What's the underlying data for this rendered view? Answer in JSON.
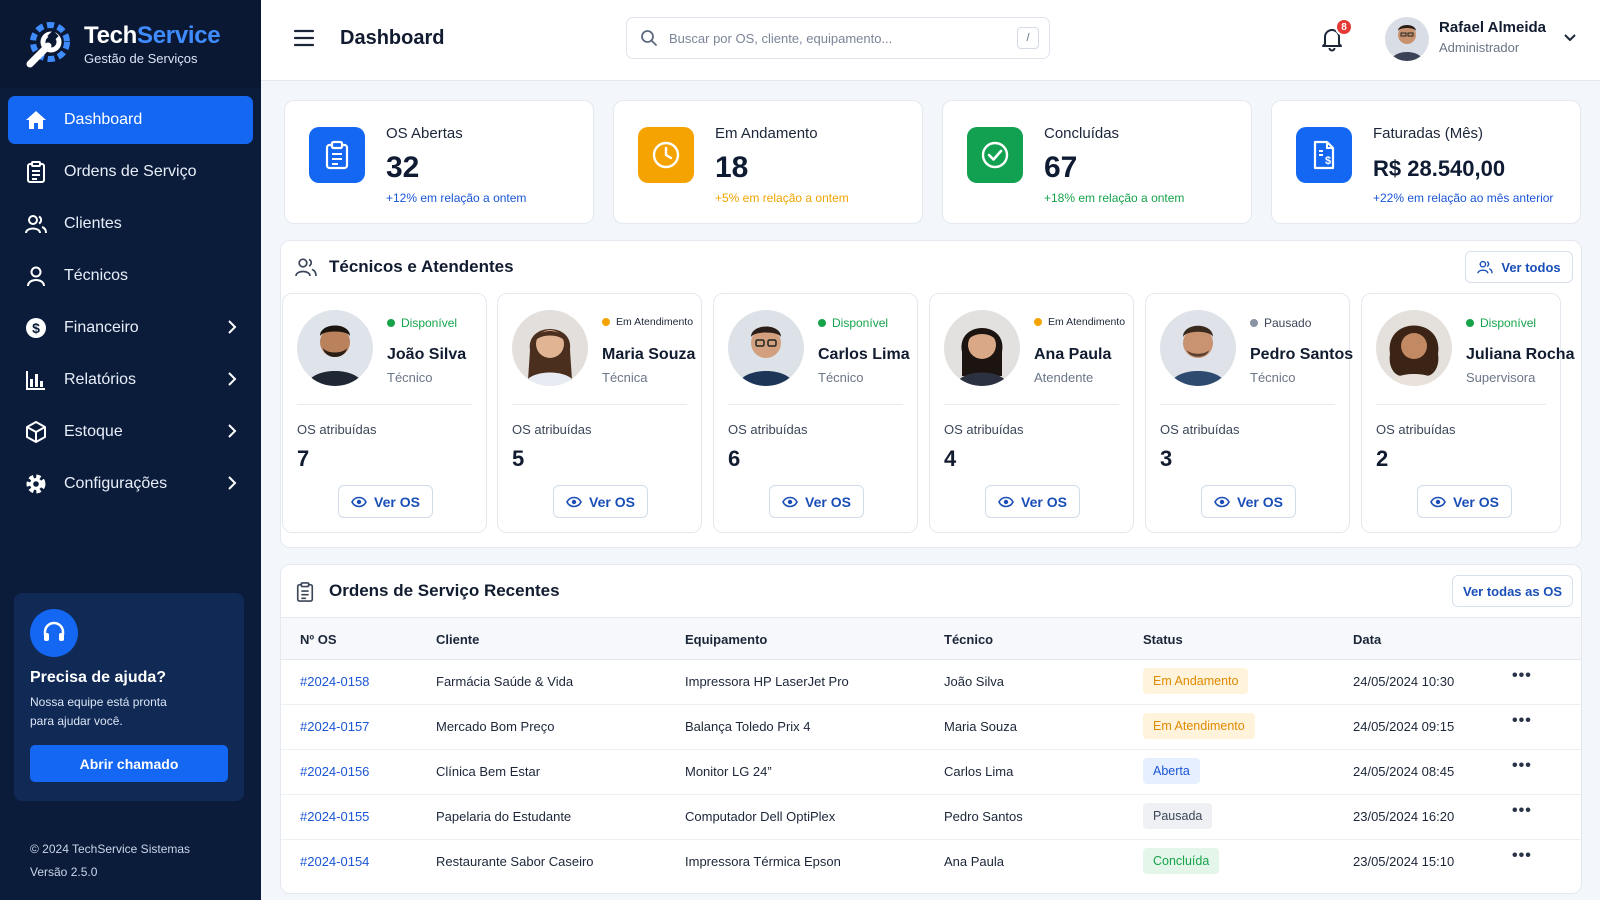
{
  "brand": {
    "name_part1": "Tech",
    "name_part2": "Service",
    "subtitle": "Gestão de Serviços"
  },
  "nav": {
    "items": [
      {
        "label": "Dashboard",
        "icon": "home-icon",
        "active": true
      },
      {
        "label": "Ordens de Serviço",
        "icon": "clipboard-icon"
      },
      {
        "label": "Clientes",
        "icon": "users-icon"
      },
      {
        "label": "Técnicos",
        "icon": "user-icon"
      },
      {
        "label": "Financeiro",
        "icon": "dollar-icon",
        "has_submenu": true
      },
      {
        "label": "Relatórios",
        "icon": "bar-chart-icon",
        "has_submenu": true
      },
      {
        "label": "Estoque",
        "icon": "box-icon",
        "has_submenu": true
      },
      {
        "label": "Configurações",
        "icon": "gear-icon",
        "has_submenu": true
      }
    ]
  },
  "help": {
    "title": "Precisa de ajuda?",
    "text": "Nossa equipe está pronta para ajudar você.",
    "button": "Abrir chamado"
  },
  "footer": {
    "copyright": "© 2024 TechService Sistemas",
    "version": "Versão 2.5.0"
  },
  "header": {
    "title": "Dashboard",
    "search_placeholder": "Buscar por OS, cliente, equipamento...",
    "search_shortcut": "/",
    "notifications": "8",
    "user_name": "Rafael Almeida",
    "user_role": "Administrador"
  },
  "stats": [
    {
      "title": "OS Abertas",
      "value": "32",
      "note": "+12% em relação a ontem",
      "color": "#1467f2",
      "note_color": "#1a56d6",
      "icon": "clipboard-icon"
    },
    {
      "title": "Em Andamento",
      "value": "18",
      "note": "+5% em relação a ontem",
      "color": "#f5a300",
      "note_color": "#f0a400",
      "icon": "clock-icon"
    },
    {
      "title": "Concluídas",
      "value": "67",
      "note": "+18% em relação a ontem",
      "color": "#12a150",
      "note_color": "#16a34a",
      "icon": "check-circle-icon"
    },
    {
      "title": "Faturadas (Mês)",
      "value": "R$ 28.540,00",
      "note": "+22% em relação ao mês anterior",
      "color": "#1467f2",
      "note_color": "#1a56d6",
      "icon": "invoice-icon"
    }
  ],
  "technicians": {
    "title": "Técnicos e Atendentes",
    "view_all": "Ver todos",
    "assigned_label": "OS atribuídas",
    "view_button": "Ver OS",
    "items": [
      {
        "name": "João Silva",
        "role": "Técnico",
        "status": "Disponível",
        "status_color": "#16a34a",
        "count": "7"
      },
      {
        "name": "Maria Souza",
        "role": "Técnica",
        "status": "Em Atendimento",
        "status_color": "#f5a300",
        "count": "5"
      },
      {
        "name": "Carlos Lima",
        "role": "Técnico",
        "status": "Disponível",
        "status_color": "#16a34a",
        "count": "6"
      },
      {
        "name": "Ana Paula",
        "role": "Atendente",
        "status": "Em Atendimento",
        "status_color": "#f5a300",
        "count": "4"
      },
      {
        "name": "Pedro Santos",
        "role": "Técnico",
        "status": "Pausado",
        "status_color": "#8a93a3",
        "count": "3"
      },
      {
        "name": "Juliana Rocha",
        "role": "Supervisora",
        "status": "Disponível",
        "status_color": "#16a34a",
        "count": "2"
      }
    ]
  },
  "orders": {
    "title": "Ordens de Serviço Recentes",
    "view_all": "Ver todas as OS",
    "columns": [
      "Nº OS",
      "Cliente",
      "Equipamento",
      "Técnico",
      "Status",
      "Data"
    ],
    "rows": [
      {
        "id": "#2024-0158",
        "client": "Farmácia Saúde & Vida",
        "equipment": "Impressora HP LaserJet Pro",
        "tech": "João Silva",
        "status": "Em Andamento",
        "status_bg": "#fff3dc",
        "status_fg": "#e08a00",
        "date": "24/05/2024 10:30"
      },
      {
        "id": "#2024-0157",
        "client": "Mercado Bom Preço",
        "equipment": "Balança Toledo Prix 4",
        "tech": "Maria Souza",
        "status": "Em Atendimento",
        "status_bg": "#fff3dc",
        "status_fg": "#e08a00",
        "date": "24/05/2024 09:15"
      },
      {
        "id": "#2024-0156",
        "client": "Clínica Bem Estar",
        "equipment": "Monitor LG 24”",
        "tech": "Carlos Lima",
        "status": "Aberta",
        "status_bg": "#e6efff",
        "status_fg": "#1a56d6",
        "date": "24/05/2024 08:45"
      },
      {
        "id": "#2024-0155",
        "client": "Papelaria do Estudante",
        "equipment": "Computador Dell OptiPlex",
        "tech": "Pedro Santos",
        "status": "Pausada",
        "status_bg": "#eef0f3",
        "status_fg": "#3c4659",
        "date": "23/05/2024 16:20"
      },
      {
        "id": "#2024-0154",
        "client": "Restaurante Sabor Caseiro",
        "equipment": "Impressora Térmica Epson",
        "tech": "Ana Paula",
        "status": "Concluída",
        "status_bg": "#e4f6ea",
        "status_fg": "#16a34a",
        "date": "23/05/2024 15:10"
      }
    ]
  }
}
